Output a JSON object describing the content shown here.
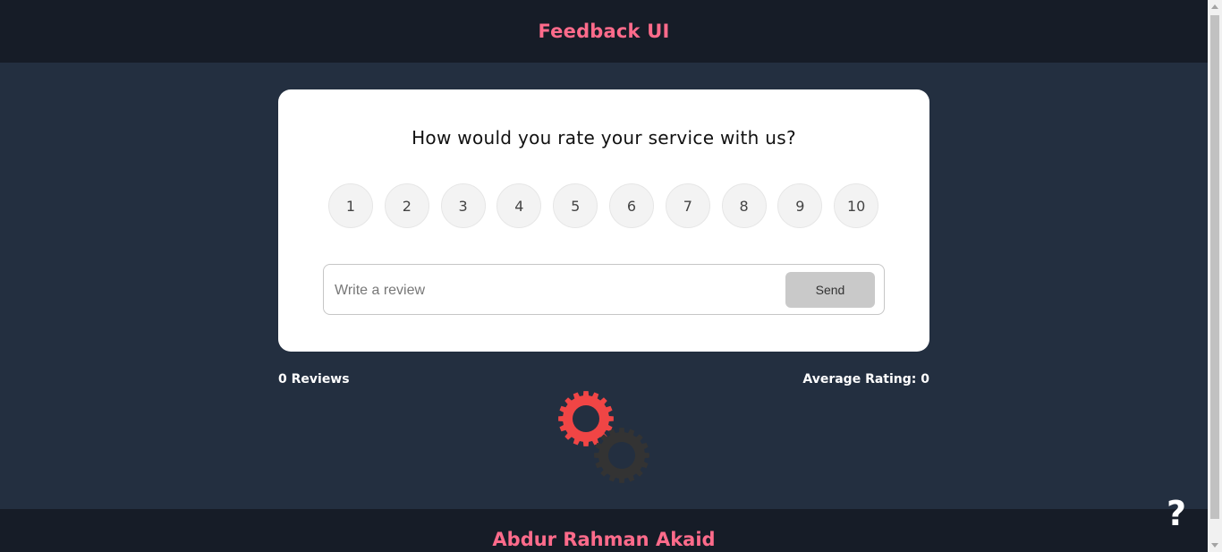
{
  "header": {
    "title": "Feedback UI"
  },
  "card": {
    "question": "How would you rate your service with us?",
    "ratings": [
      "1",
      "2",
      "3",
      "4",
      "5",
      "6",
      "7",
      "8",
      "9",
      "10"
    ],
    "review": {
      "placeholder": "Write a review",
      "value": ""
    },
    "send_label": "Send"
  },
  "stats": {
    "reviews_label": "0 Reviews",
    "average_label": "Average Rating: 0"
  },
  "footer": {
    "author": "Abdur Rahman Akaid"
  },
  "help": {
    "label": "?"
  },
  "colors": {
    "accent": "#ff6b8b",
    "page_bg": "#232f40",
    "header_bg": "#161c27",
    "gear_red": "#f04545",
    "gear_dark": "#333333"
  },
  "icons": {
    "loading": "gears-icon"
  }
}
